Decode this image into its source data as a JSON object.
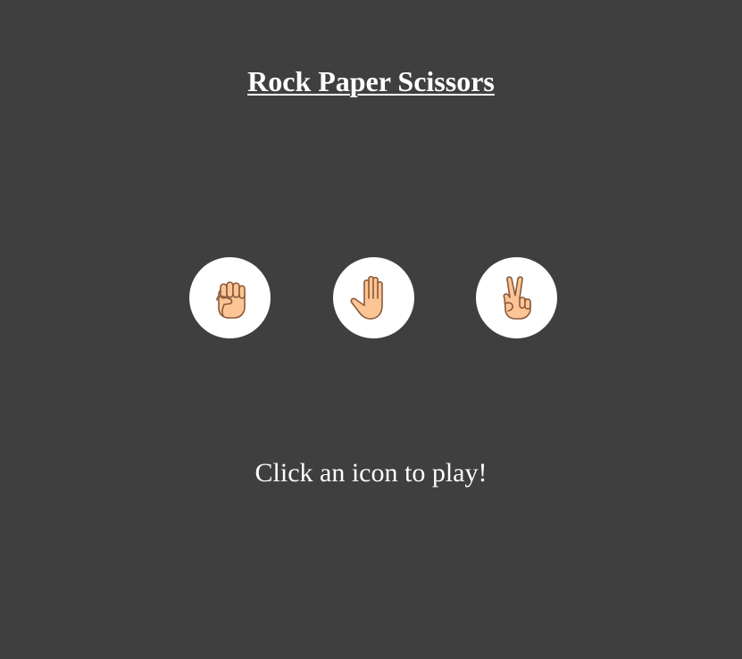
{
  "title": "Rock Paper Scissors",
  "choices": [
    {
      "label": "rock",
      "icon": "rock-hand-icon"
    },
    {
      "label": "paper",
      "icon": "paper-hand-icon"
    },
    {
      "label": "scissors",
      "icon": "scissors-hand-icon"
    }
  ],
  "message": "Click an icon to play!",
  "colors": {
    "background": "#3f3f3f",
    "text": "#ffffff",
    "button": "#ffffff",
    "skin": "#fdc595",
    "skin_outline": "#8a5a3b"
  }
}
